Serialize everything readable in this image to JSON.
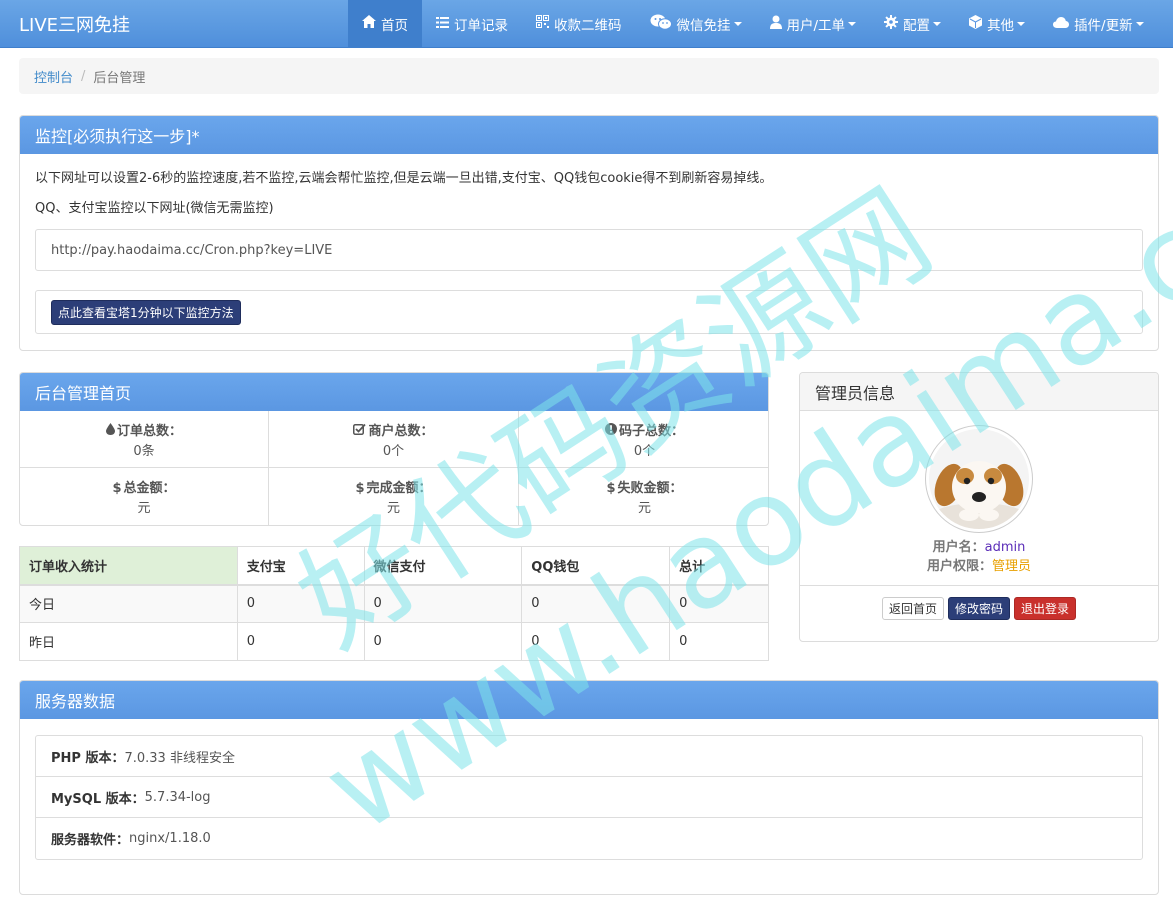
{
  "navbar": {
    "brand": "LIVE三网免挂",
    "items": [
      {
        "label": "首页",
        "icon": "home-icon",
        "active": true
      },
      {
        "label": "订单记录",
        "icon": "list-icon"
      },
      {
        "label": "收款二维码",
        "icon": "qrcode-icon"
      },
      {
        "label": "微信免挂",
        "icon": "wechat-icon",
        "dropdown": true
      },
      {
        "label": "用户/工单",
        "icon": "user-icon",
        "dropdown": true
      },
      {
        "label": "配置",
        "icon": "gear-icon",
        "dropdown": true
      },
      {
        "label": "其他",
        "icon": "cube-icon",
        "dropdown": true
      },
      {
        "label": "插件/更新",
        "icon": "cloud-icon",
        "dropdown": true
      }
    ]
  },
  "breadcrumb": {
    "home": "控制台",
    "current": "后台管理"
  },
  "monitor": {
    "title": "监控[必须执行这一步]*",
    "line1": "以下网址可以设置2-6秒的监控速度,若不监控,云端会帮忙监控,但是云端一旦出错,支付宝、QQ钱包cookie得不到刷新容易掉线。",
    "line2": "QQ、支付宝监控以下网址(微信无需监控)",
    "url": "http://pay.haodaima.cc/Cron.php?key=LIVE",
    "button": "点此查看宝塔1分钟以下监控方法"
  },
  "stats": {
    "title": "后台管理首页",
    "cells": [
      {
        "icon": "drop-icon",
        "label": "订单总数：",
        "value": "0条"
      },
      {
        "icon": "check-icon",
        "label": "商户总数：",
        "value": "0个"
      },
      {
        "icon": "info-icon",
        "label": "码子总数：",
        "value": "0个"
      },
      {
        "icon": "dollar-icon",
        "label": "总金额：",
        "value": "元"
      },
      {
        "icon": "dollar-icon",
        "label": "完成金额：",
        "value": "元"
      },
      {
        "icon": "dollar-icon",
        "label": "失败金额：",
        "value": "元"
      }
    ]
  },
  "income": {
    "headers": [
      "订单收入统计",
      "支付宝",
      "微信支付",
      "QQ钱包",
      "总计"
    ],
    "rows": [
      [
        "今日",
        "0",
        "0",
        "0",
        "0"
      ],
      [
        "昨日",
        "0",
        "0",
        "0",
        "0"
      ]
    ]
  },
  "admin": {
    "title": "管理员信息",
    "username_label": "用户名：",
    "username": "admin",
    "role_label": "用户权限：",
    "role": "管理员",
    "btn_home": "返回首页",
    "btn_password": "修改密码",
    "btn_logout": "退出登录"
  },
  "server": {
    "title": "服务器数据",
    "items": [
      {
        "label": "PHP 版本：",
        "value": "7.0.33 非线程安全"
      },
      {
        "label": "MySQL 版本：",
        "value": "5.7.34-log"
      },
      {
        "label": "服务器软件：",
        "value": "nginx/1.18.0"
      }
    ]
  },
  "watermark": {
    "line1": "好代码资源网",
    "line2": "www.haodaima.cc",
    "color": "#7de3ea"
  },
  "colors": {
    "nav": "#5b97e2",
    "panel_head": "#5d9cec",
    "btn_dark": "#2c3e78",
    "btn_danger": "#c9302c",
    "link": "#428bca"
  }
}
